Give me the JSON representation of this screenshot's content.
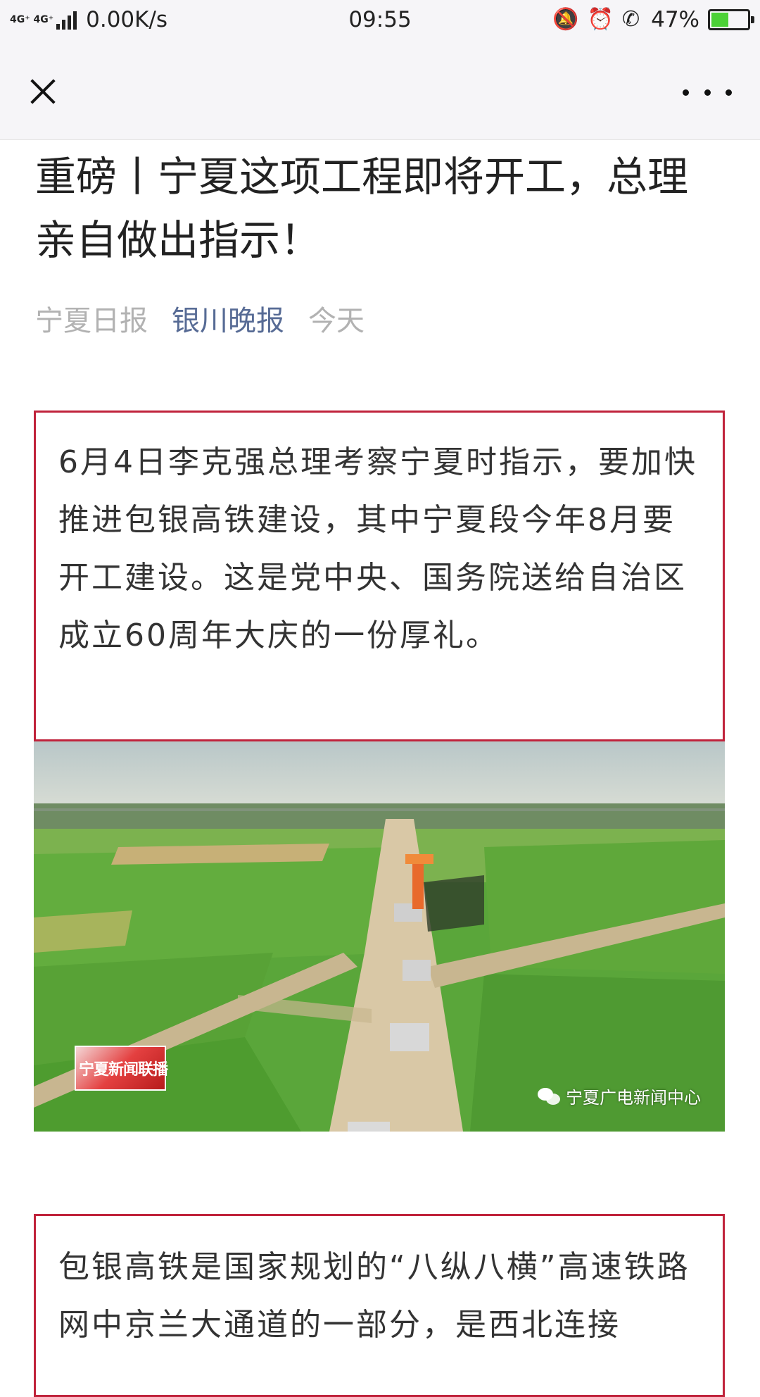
{
  "status_bar": {
    "network_label": "4G⁺ 4G⁺",
    "speed": "0.00K/s",
    "time": "09:55",
    "battery_percent": "47%",
    "battery_level": 0.47,
    "icons": [
      "bell-off-icon",
      "alarm-icon",
      "hd-call-icon"
    ]
  },
  "nav": {
    "close_icon": "close-icon",
    "more_icon": "more-icon"
  },
  "article": {
    "title": "重磅丨宁夏这项工程即将开工，总理亲自做出指示！",
    "source": "宁夏日报",
    "account": "银川晚报",
    "date": "今天",
    "box1_text": "6月4日李克强总理考察宁夏时指示，要加快推进包银高铁建设，其中宁夏段今年8月要开工建设。这是党中央、国务院送给自治区成立60周年大庆的一份厚礼。",
    "image": {
      "tv_logo_text": "宁夏新闻联播",
      "watermark": "宁夏广电新闻中心"
    },
    "box2_text": "包银高铁是国家规划的“八纵八横”高速铁路网中京兰大通道的一部分，是西北连接"
  }
}
